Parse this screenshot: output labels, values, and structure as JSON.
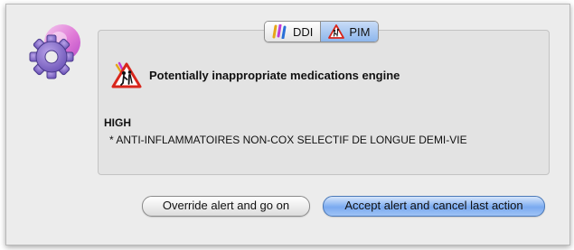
{
  "tabs": [
    {
      "label": "DDI",
      "icon": "ddi-icon",
      "selected": false
    },
    {
      "label": "PIM",
      "icon": "elderly-warning-icon",
      "selected": true
    }
  ],
  "engine": {
    "title": "Potentially inappropriate medications engine",
    "icon": "elderly-warning-icon"
  },
  "alert": {
    "level": "HIGH",
    "items": [
      "* ANTI-INFLAMMATOIRES NON-COX SELECTIF DE LONGUE DEMI-VIE"
    ]
  },
  "buttons": {
    "override_label": "Override alert and go on",
    "accept_label": "Accept alert and cancel last action"
  },
  "colors": {
    "warning": "#d8261c",
    "accent": "#7aaaf0"
  }
}
